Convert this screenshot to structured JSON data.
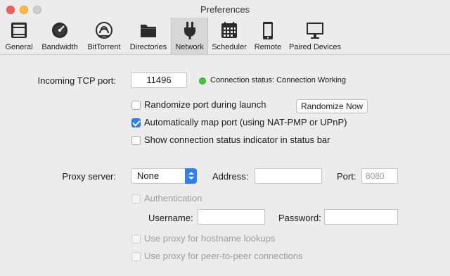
{
  "window": {
    "title": "Preferences"
  },
  "toolbar": {
    "items": [
      {
        "label": "General",
        "icon": "general-icon"
      },
      {
        "label": "Bandwidth",
        "icon": "gauge-icon"
      },
      {
        "label": "BitTorrent",
        "icon": "bittorrent-icon"
      },
      {
        "label": "Directories",
        "icon": "folder-icon"
      },
      {
        "label": "Network",
        "icon": "plug-icon",
        "selected": true
      },
      {
        "label": "Scheduler",
        "icon": "calendar-icon"
      },
      {
        "label": "Remote",
        "icon": "phone-icon"
      },
      {
        "label": "Paired Devices",
        "icon": "monitor-icon"
      }
    ]
  },
  "network": {
    "incoming_port_label": "Incoming TCP port:",
    "incoming_port_value": "11496",
    "status_text": "Connection status: Connection Working",
    "status_color": "#3dc83d",
    "randomize_label": "Randomize port during launch",
    "randomize_checked": false,
    "randomize_button": "Randomize Now",
    "automap_label": "Automatically map port (using NAT-PMP or UPnP)",
    "automap_checked": true,
    "show_status_label": "Show connection status indicator in status bar",
    "show_status_checked": false
  },
  "proxy": {
    "server_label": "Proxy server:",
    "server_value": "None",
    "address_label": "Address:",
    "address_value": "",
    "port_label": "Port:",
    "port_placeholder": "8080",
    "auth_label": "Authentication",
    "username_label": "Username:",
    "username_value": "",
    "password_label": "Password:",
    "password_value": "",
    "hostname_lookup_label": "Use proxy for hostname lookups",
    "peer_label": "Use proxy for peer-to-peer connections"
  },
  "colors": {
    "accent": "#2f7ff6"
  }
}
